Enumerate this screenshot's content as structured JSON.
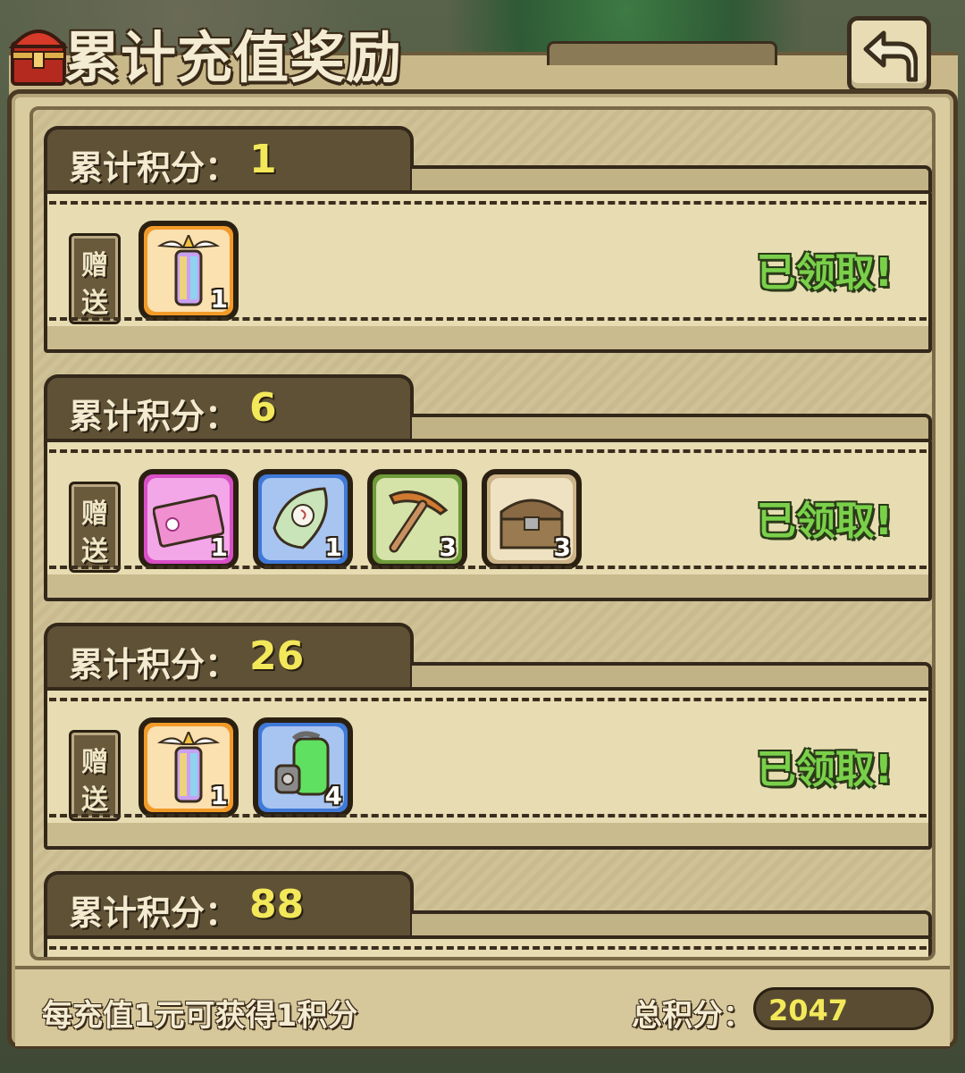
{
  "header": {
    "title": "累计充值奖励",
    "back_icon": "back-arrow-icon",
    "chest_icon": "treasure-chest-icon"
  },
  "tiers": [
    {
      "label": "累计积分：",
      "points": "1",
      "gift_label_top": "赠",
      "gift_label_bottom": "送",
      "status": "已领取!",
      "items": [
        {
          "icon": "winged-lantern-icon",
          "rarity": "orange",
          "qty": "1"
        }
      ]
    },
    {
      "label": "累计积分：",
      "points": "6",
      "gift_label_top": "赠",
      "gift_label_bottom": "送",
      "status": "已领取!",
      "items": [
        {
          "icon": "ticket-icon",
          "rarity": "pink",
          "qty": "1"
        },
        {
          "icon": "leaf-seed-icon",
          "rarity": "blue",
          "qty": "1"
        },
        {
          "icon": "pickaxe-icon",
          "rarity": "green",
          "qty": "3"
        },
        {
          "icon": "wooden-chest-icon",
          "rarity": "tan",
          "qty": "3"
        }
      ]
    },
    {
      "label": "累计积分：",
      "points": "26",
      "gift_label_top": "赠",
      "gift_label_bottom": "送",
      "status": "已领取!",
      "items": [
        {
          "icon": "winged-lantern-icon",
          "rarity": "orange",
          "qty": "1"
        },
        {
          "icon": "green-canister-icon",
          "rarity": "blue",
          "qty": "4"
        }
      ]
    },
    {
      "label": "累计积分：",
      "points": "88"
    }
  ],
  "footer": {
    "rule": "每充值1元可获得1积分",
    "total_label": "总积分：",
    "total_value": "2047"
  },
  "colors": {
    "claimed_green": "#7ad04a",
    "points_yellow": "#f2e85a",
    "rarity_orange": "#f29a28",
    "rarity_pink": "#d94fc6",
    "rarity_blue": "#3f79d8",
    "rarity_green": "#6f9b3a",
    "rarity_tan": "#cdb58a"
  }
}
